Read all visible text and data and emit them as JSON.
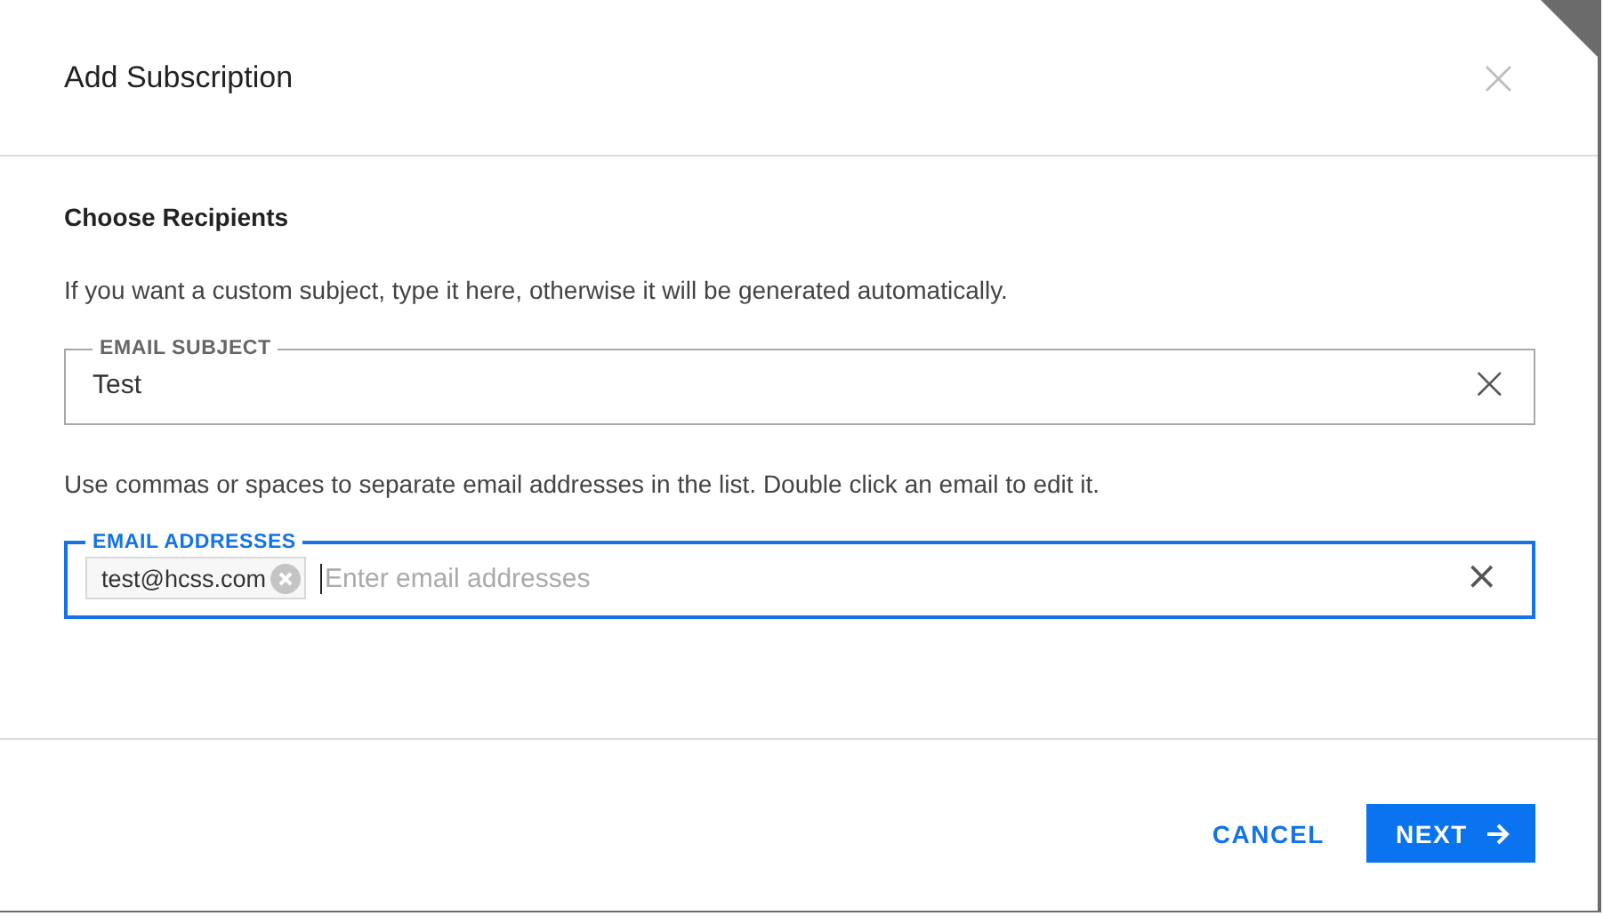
{
  "dialog": {
    "title": "Add Subscription",
    "close": "×"
  },
  "section": {
    "heading": "Choose Recipients"
  },
  "subject_hint": "If you want a custom subject, type it here, otherwise it will be generated automatically.",
  "subject_field": {
    "label": "EMAIL SUBJECT",
    "value": "Test",
    "focused": false,
    "clear": "×"
  },
  "addresses_hint": "Use commas or spaces to separate email addresses in the list. Double click an email to edit it.",
  "addresses_field": {
    "label": "EMAIL ADDRESSES",
    "focused": true,
    "clear": "×",
    "placeholder": "Enter email addresses",
    "chips": [
      {
        "text": "test@hcss.com"
      }
    ]
  },
  "buttons": [
    {
      "label": "CANCEL",
      "kind": "text"
    },
    {
      "label": "NEXT",
      "kind": "primary"
    }
  ]
}
